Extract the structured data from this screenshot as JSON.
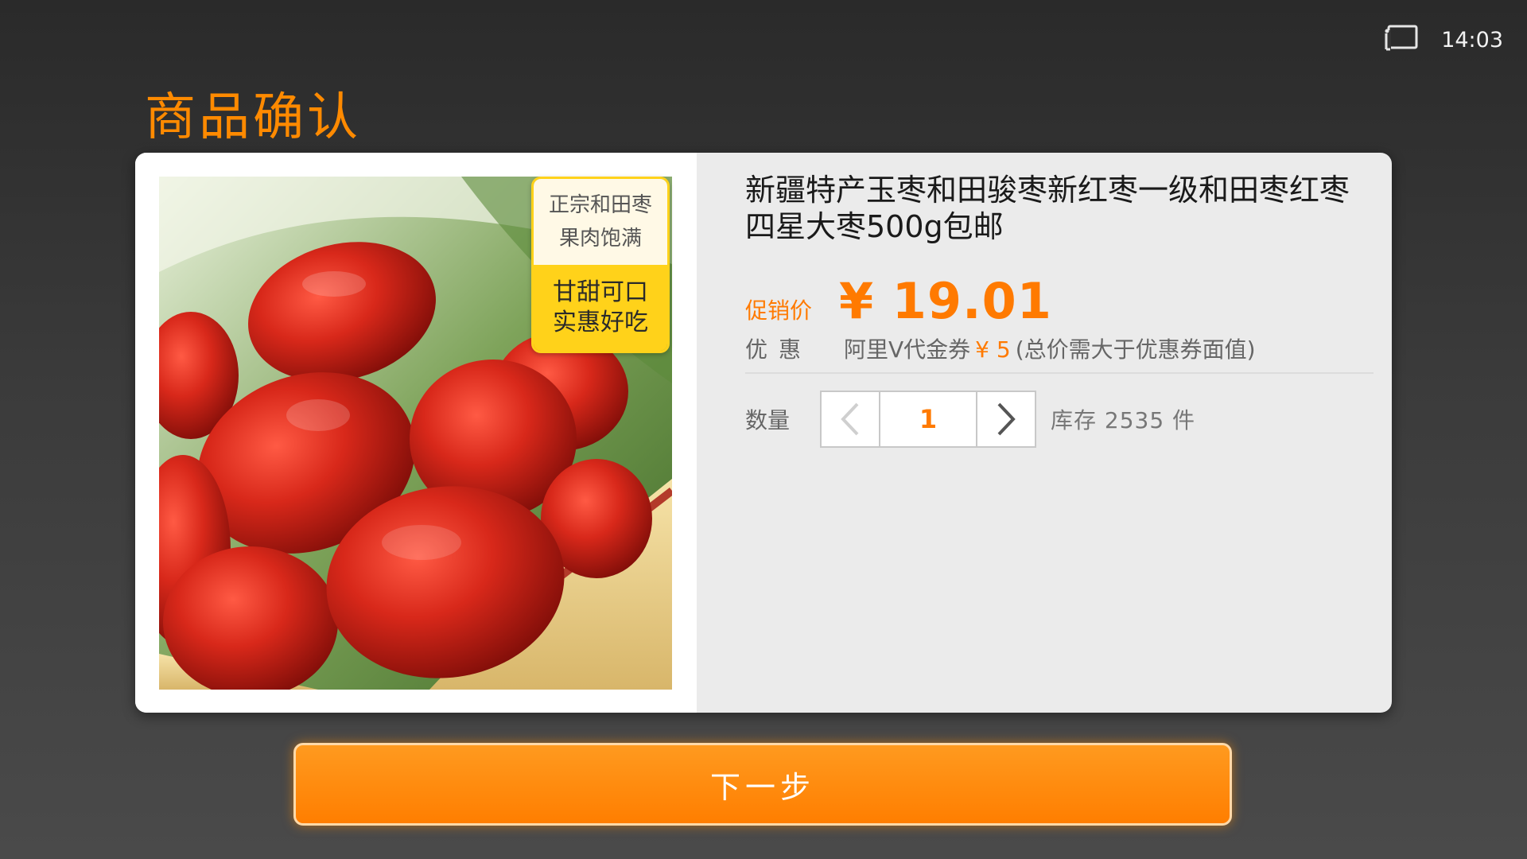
{
  "status": {
    "time": "14:03",
    "cast_icon": "cast-screen-icon"
  },
  "page": {
    "title": "商品确认"
  },
  "product": {
    "title": "新疆特产玉枣和田骏枣新红枣一级和田枣红枣四星大枣500g包邮",
    "image_icon": "red-dates-product-image",
    "promo_tag": {
      "top_line1": "正宗和田枣",
      "top_line2": "果肉饱满",
      "bottom_line1": "甘甜可口",
      "bottom_line2": "实惠好吃"
    },
    "price_label": "促销价",
    "price": "¥ 19.01",
    "discount": {
      "label": "优惠",
      "text_prefix": "阿里V代金券",
      "amount": "¥ 5",
      "text_suffix": "(总价需大于优惠券面值)"
    },
    "quantity": {
      "label": "数量",
      "value": "1",
      "decrement_icon": "chevron-left-icon",
      "increment_icon": "chevron-right-icon"
    },
    "stock_text": "库存  2535  件"
  },
  "actions": {
    "next_label": "下一步"
  },
  "colors": {
    "accent": "#ff7a00",
    "title_orange": "#ff8a00",
    "tag_yellow": "#ffd21a",
    "background": "#333333"
  }
}
